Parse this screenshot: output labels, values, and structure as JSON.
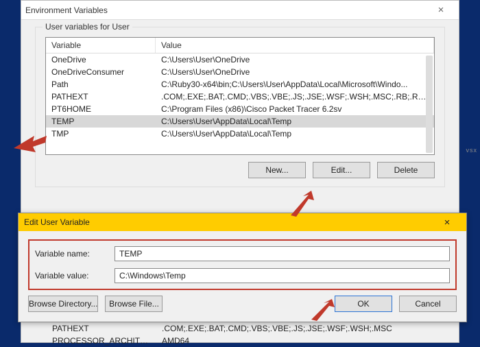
{
  "env_window": {
    "title": "Environment Variables",
    "group_label": "User variables for User",
    "columns": {
      "variable": "Variable",
      "value": "Value"
    },
    "rows": [
      {
        "variable": "OneDrive",
        "value": "C:\\Users\\User\\OneDrive"
      },
      {
        "variable": "OneDriveConsumer",
        "value": "C:\\Users\\User\\OneDrive"
      },
      {
        "variable": "Path",
        "value": "C:\\Ruby30-x64\\bin;C:\\Users\\User\\AppData\\Local\\Microsoft\\Windo..."
      },
      {
        "variable": "PATHEXT",
        "value": ".COM;.EXE;.BAT;.CMD;.VBS;.VBE;.JS;.JSE;.WSF;.WSH;.MSC;.RB;.RBW;..."
      },
      {
        "variable": "PT6HOME",
        "value": "C:\\Program Files (x86)\\Cisco Packet Tracer 6.2sv"
      },
      {
        "variable": "TEMP",
        "value": "C:\\Users\\User\\AppData\\Local\\Temp"
      },
      {
        "variable": "TMP",
        "value": "C:\\Users\\User\\AppData\\Local\\Temp"
      }
    ],
    "selected_index": 5,
    "buttons": {
      "new": "New...",
      "edit": "Edit...",
      "delete": "Delete"
    }
  },
  "parent_rows": [
    {
      "variable": "PATHEXT",
      "value": ".COM;.EXE;.BAT;.CMD;.VBS;.VBE;.JS;.JSE;.WSF;.WSH;.MSC"
    },
    {
      "variable": "PROCESSOR_ARCHITECTURE",
      "value": "AMD64"
    }
  ],
  "edit_dialog": {
    "title": "Edit User Variable",
    "name_label": "Variable name:",
    "name_value": "TEMP",
    "value_label": "Variable value:",
    "value_value": "C:\\Windows\\Temp",
    "buttons": {
      "browse_dir": "Browse Directory...",
      "browse_file": "Browse File...",
      "ok": "OK",
      "cancel": "Cancel"
    }
  },
  "watermark": "vsx"
}
